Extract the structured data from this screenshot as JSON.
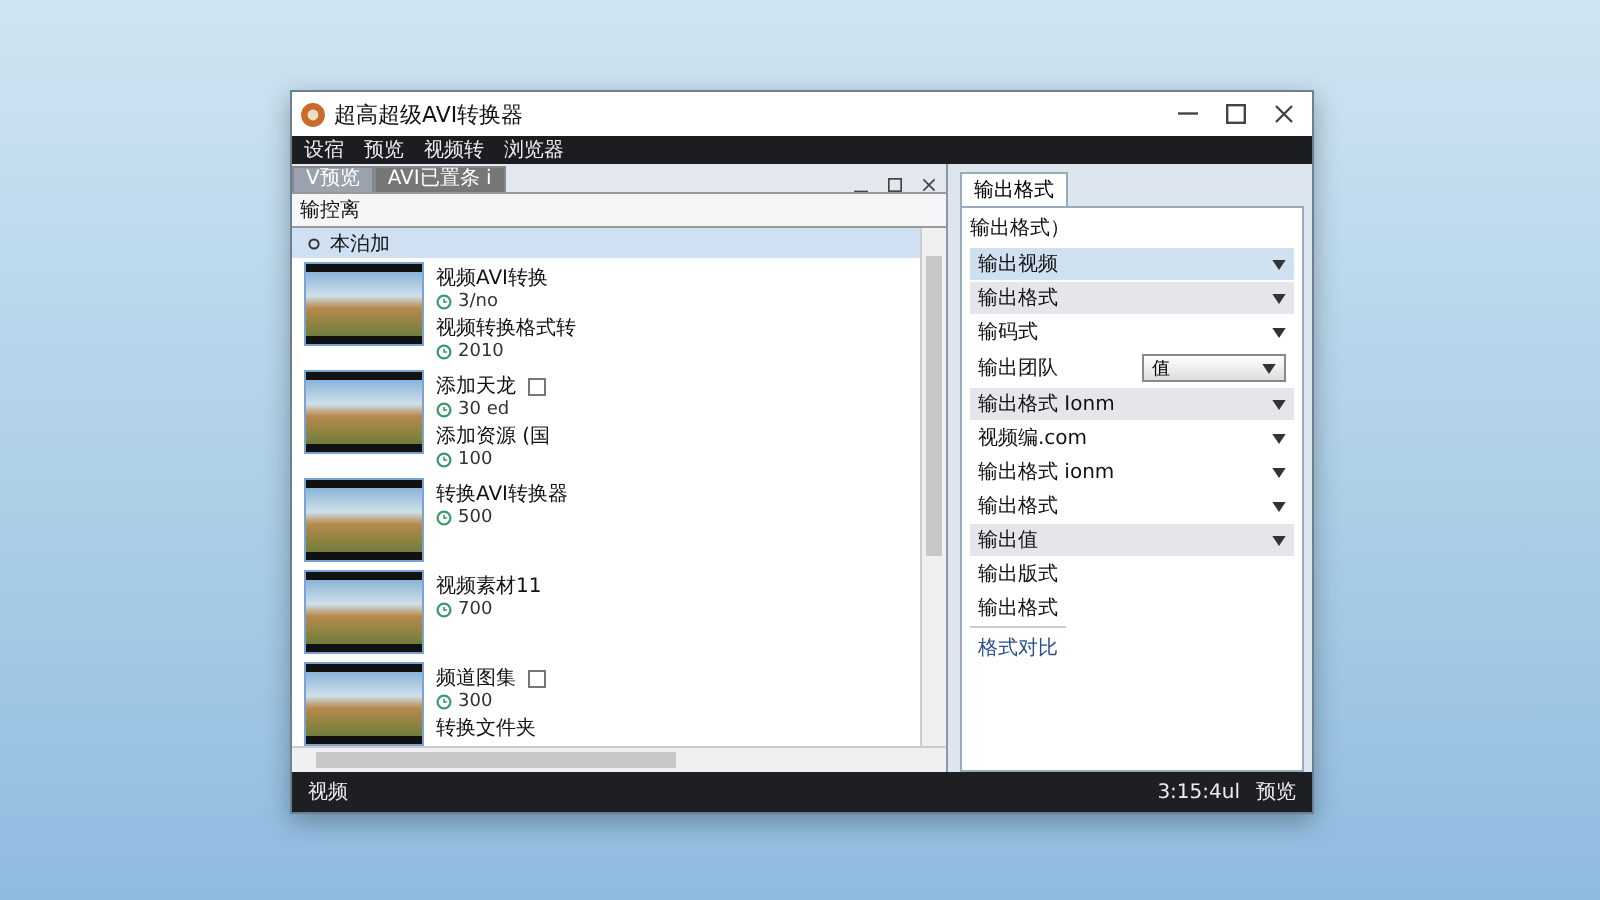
{
  "window": {
    "title": "超高超级AVI转换器"
  },
  "menu": [
    "设宿",
    "预览",
    "视频转",
    "浏览器"
  ],
  "left_panel": {
    "tabs": [
      {
        "label": "V预览",
        "selected": true
      },
      {
        "label": "AVI已置条 i",
        "selected": false
      }
    ],
    "heading": "输控离",
    "group": {
      "label": "本泊加",
      "expanded": true
    },
    "items": [
      {
        "entries": [
          {
            "title": "视频AVI转换",
            "meta": "3/no",
            "tag": false
          },
          {
            "title": "视频转换格式转",
            "meta": "2010",
            "tag": false
          }
        ]
      },
      {
        "entries": [
          {
            "title": "添加天龙",
            "meta": "30 ed",
            "tag": true
          },
          {
            "title": "添加资源 (国",
            "meta": "100",
            "tag": false
          }
        ]
      },
      {
        "entries": [
          {
            "title": "转换AVI转换器",
            "meta": "500",
            "tag": false
          }
        ]
      },
      {
        "entries": [
          {
            "title": "视频素材11",
            "meta": "700",
            "tag": false
          }
        ]
      },
      {
        "entries": [
          {
            "title": "频道图集",
            "meta": "300",
            "tag": true
          },
          {
            "title": "转换文件夹",
            "tag": false
          }
        ]
      }
    ]
  },
  "right_panel": {
    "tab": "输出格式",
    "label": "输出格式）",
    "rows": [
      {
        "kind": "dropdown",
        "label": "输出视频",
        "selected": true,
        "shaded": false
      },
      {
        "kind": "dropdown",
        "label": "输出格式",
        "selected": false,
        "shaded": true
      },
      {
        "kind": "dropdown",
        "label": "输码式",
        "selected": false,
        "shaded": false
      },
      {
        "kind": "select",
        "label": "输出团队",
        "value": "值"
      },
      {
        "kind": "dropdown",
        "label": "输出格式 Ionm",
        "selected": false,
        "shaded": true
      },
      {
        "kind": "dropdown",
        "label": "视频编.com",
        "selected": false,
        "shaded": false
      },
      {
        "kind": "dropdown",
        "label": "输出格式 ionm",
        "selected": false,
        "shaded": false
      },
      {
        "kind": "dropdown",
        "label": "输出格式",
        "selected": false,
        "shaded": false
      },
      {
        "kind": "dropdown",
        "label": "输出值",
        "selected": false,
        "shaded": true
      },
      {
        "kind": "text",
        "label": "输出版式"
      },
      {
        "kind": "text",
        "label": "输出格式"
      },
      {
        "kind": "link",
        "label": "格式对比"
      }
    ]
  },
  "status_bar": {
    "left": "视频",
    "time": "3:15:4ul",
    "right": "预览"
  }
}
